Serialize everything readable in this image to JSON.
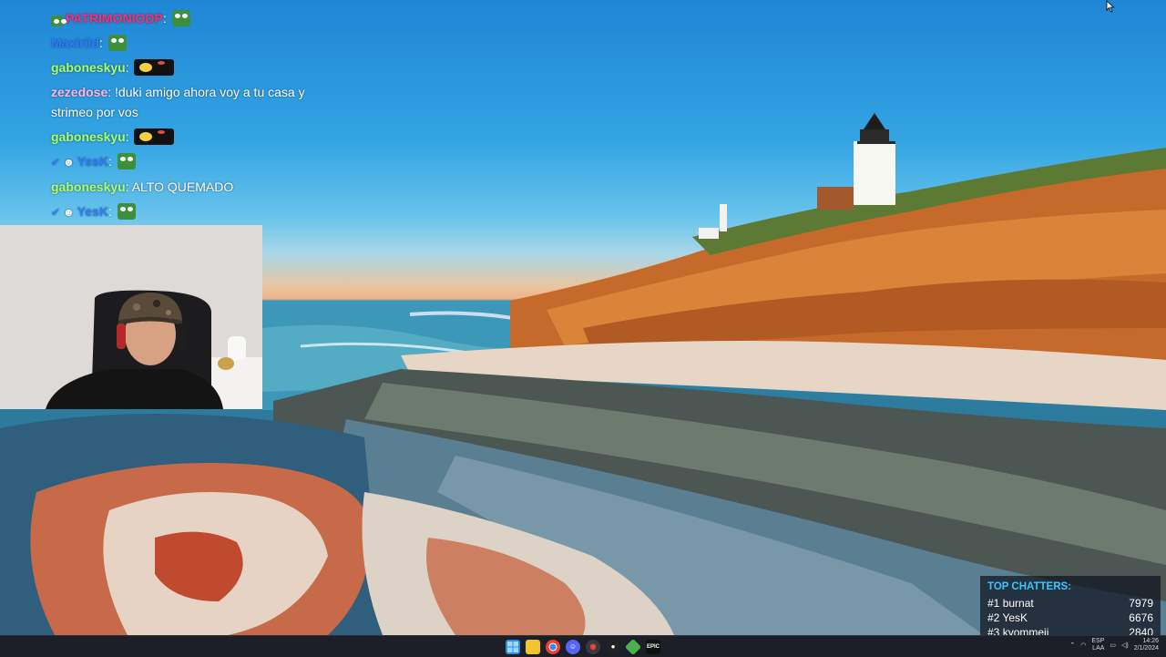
{
  "chat": {
    "messages": [
      {
        "user": "PATRIMONIODP",
        "text": "",
        "color": "#ff2d6f",
        "emote": "pepe-emote"
      },
      {
        "user": "Maxirild",
        "text": "",
        "color": "#2f7bff",
        "emote": "pepe-emote"
      },
      {
        "user": "gaboneskyu",
        "text": "",
        "color": "#a8ff6a",
        "emote": "minion-emote"
      },
      {
        "user": "zezedose",
        "text": "!duki amigo ahora voy a tu casa y strimeo por vos",
        "color": "#ffb6e6",
        "emote": ""
      },
      {
        "user": "gaboneskyu",
        "text": "",
        "color": "#a8ff6a",
        "emote": "minion-emote"
      },
      {
        "user": "YesK",
        "text": "",
        "color": "#2f7bff",
        "emote": "pepe-emote"
      },
      {
        "user": "gaboneskyu",
        "text": "ALTO QUEMADO",
        "color": "#a8ff6a",
        "emote": ""
      },
      {
        "user": "YesK",
        "text": "",
        "color": "#2f7bff",
        "emote": "pepe-emote"
      }
    ]
  },
  "top_chatters": {
    "title": "TOP CHATTERS:",
    "rows": [
      {
        "rank": "#1",
        "name": "burnat",
        "count": "7979"
      },
      {
        "rank": "#2",
        "name": "YesK",
        "count": "6676"
      },
      {
        "rank": "#3",
        "name": "kyommeii",
        "count": "2840"
      }
    ]
  },
  "taskbar": {
    "icons": [
      "windows-start-icon",
      "file-explorer-icon",
      "chrome-icon",
      "discord-icon",
      "app-red-icon",
      "obs-icon",
      "minecraft-icon",
      "epic-games-icon"
    ],
    "tray_lang": "ESP",
    "tray_lang_sub": "LAA",
    "clock_time": "14:26",
    "clock_date": "2/1/2024"
  },
  "colors": {
    "sky": "#2f9be0",
    "accent_chatters": "#39c6ff",
    "taskbar_bg": "#1c1f27"
  }
}
